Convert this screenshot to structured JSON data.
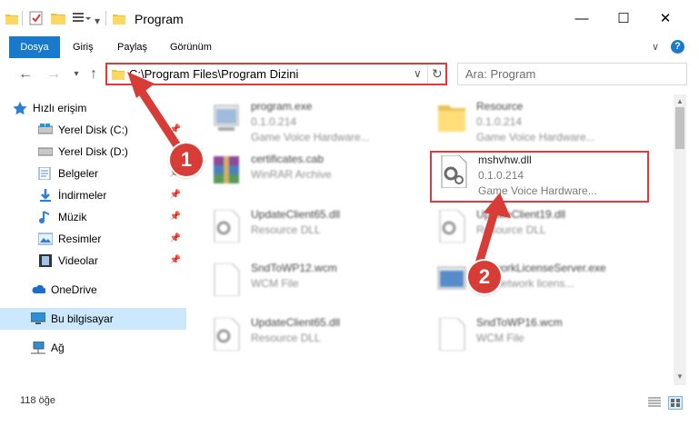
{
  "window": {
    "title": "Program",
    "controls": {
      "minimize": "—",
      "maximize": "☐",
      "close": "✕"
    }
  },
  "ribbon": {
    "tabs": [
      "Dosya",
      "Giriş",
      "Paylaş",
      "Görünüm"
    ],
    "help_icon": "?",
    "chevron": "∨"
  },
  "address": {
    "path": "C:\\Program Files\\Program Dizini",
    "search_placeholder": "Ara: Program"
  },
  "nav": {
    "quick_access": "Hızlı erişim",
    "items": [
      {
        "label": "Yerel Disk (C:)",
        "icon": "drive-icon"
      },
      {
        "label": "Yerel Disk (D:)",
        "icon": "drive-icon"
      },
      {
        "label": "Belgeler",
        "icon": "documents-icon"
      },
      {
        "label": "İndirmeler",
        "icon": "downloads-icon"
      },
      {
        "label": "Müzik",
        "icon": "music-icon"
      },
      {
        "label": "Resimler",
        "icon": "pictures-icon"
      },
      {
        "label": "Videolar",
        "icon": "videos-icon"
      }
    ],
    "onedrive": "OneDrive",
    "this_pc": "Bu bilgisayar",
    "network": "Ağ"
  },
  "files": [
    {
      "name": "program.exe",
      "line2": "0.1.0.214",
      "line3": "Game Voice Hardware...",
      "icon": "exe-icon"
    },
    {
      "name": "Resource",
      "line2": "0.1.0.214",
      "line3": "Game Voice Hardware...",
      "icon": "folder-icon"
    },
    {
      "name": "certificates.cab",
      "line2": "WinRAR Archive",
      "line3": "",
      "icon": "winrar-icon"
    },
    {
      "name": "mshvhw.dll",
      "line2": "0.1.0.214",
      "line3": "Game Voice Hardware...",
      "icon": "dll-icon"
    },
    {
      "name": "UpdateClient65.dll",
      "line2": "Resource DLL",
      "line3": "",
      "icon": "dll-icon"
    },
    {
      "name": "UpdateClient19.dll",
      "line2": "Resource DLL",
      "line3": "",
      "icon": "dll-icon"
    },
    {
      "name": "SndToWP12.wcm",
      "line2": "WCM File",
      "line3": "",
      "icon": "file-icon"
    },
    {
      "name": "NetworkLicenseServer.exe",
      "line2": "IFF network licens...",
      "line3": "",
      "icon": "app-icon"
    },
    {
      "name": "UpdateClient65.dll",
      "line2": "Resource DLL",
      "line3": "",
      "icon": "dll-icon"
    },
    {
      "name": "SndToWP16.wcm",
      "line2": "WCM File",
      "line3": "",
      "icon": "file-icon"
    }
  ],
  "status": {
    "count": "118 öğe"
  },
  "annotations": {
    "step1": "1",
    "step2": "2"
  },
  "colors": {
    "accent": "#1979ca",
    "annotation": "#d83c36",
    "selected_nav": "#cce8ff"
  }
}
